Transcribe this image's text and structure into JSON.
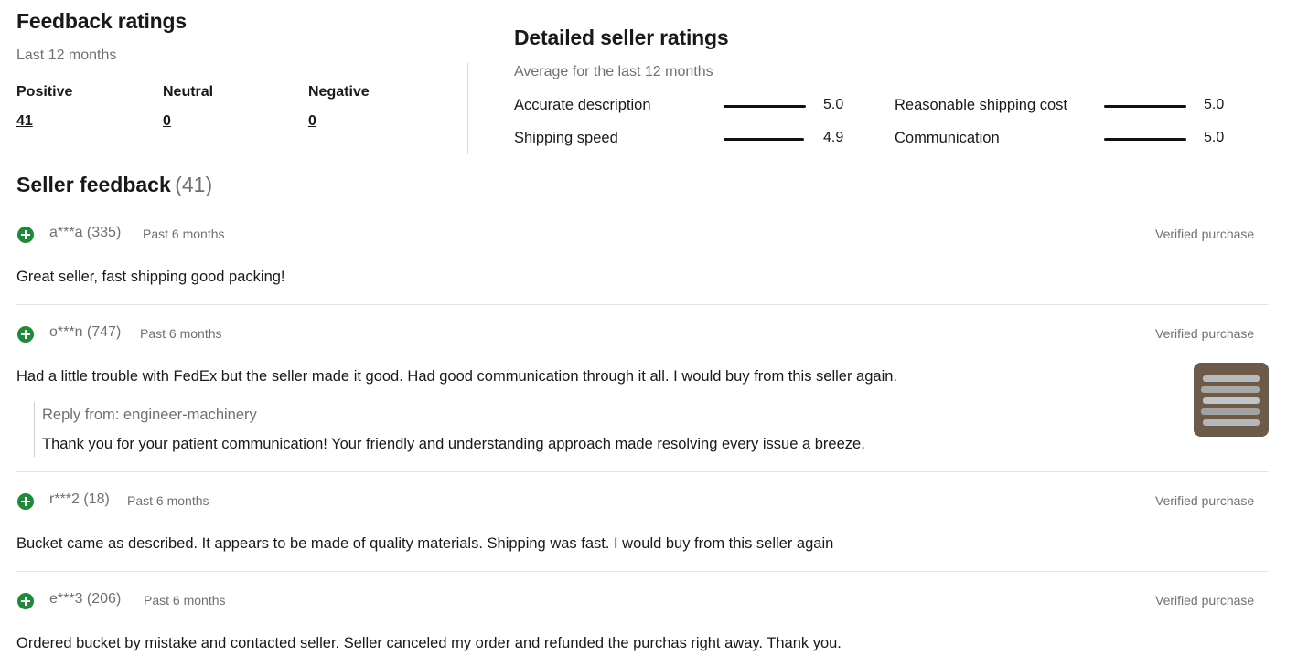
{
  "feedback_ratings": {
    "title": "Feedback ratings",
    "period": "Last 12 months",
    "positive_label": "Positive",
    "neutral_label": "Neutral",
    "negative_label": "Negative",
    "positive_count": "41",
    "neutral_count": "0",
    "negative_count": "0"
  },
  "detailed_ratings": {
    "title": "Detailed seller ratings",
    "period": "Average for the last 12 months",
    "items": [
      {
        "label": "Accurate description",
        "value": "5.0",
        "fraction": 1.0
      },
      {
        "label": "Shipping speed",
        "value": "4.9",
        "fraction": 0.98
      },
      {
        "label": "Reasonable shipping cost",
        "value": "5.0",
        "fraction": 1.0
      },
      {
        "label": "Communication",
        "value": "5.0",
        "fraction": 1.0
      }
    ]
  },
  "seller_feedback": {
    "title": "Seller feedback",
    "count": "(41)",
    "entries": [
      {
        "user": "a***a (335)",
        "time": "Past 6 months",
        "verified": "Verified purchase",
        "comment": "Great seller, fast shipping good packing!"
      },
      {
        "user": "o***n (747)",
        "time": "Past 6 months",
        "verified": "Verified purchase",
        "comment": "Had a little trouble with FedEx but the seller made it good. Had good communication through it all. I would buy from this seller again.",
        "reply_from": "Reply from: engineer-machinery",
        "reply": "Thank you for your patient communication! Your friendly and understanding approach made resolving every issue a breeze."
      },
      {
        "user": "r***2 (18)",
        "time": "Past 6 months",
        "verified": "Verified purchase",
        "comment": "Bucket came as described. It appears to be made of quality materials. Shipping was fast. I would buy from this seller again"
      },
      {
        "user": "e***3 (206)",
        "time": "Past 6 months",
        "verified": "Verified purchase",
        "comment": "Ordered bucket by mistake and contacted seller. Seller canceled my order and refunded the purchas right away. Thank you."
      }
    ]
  },
  "colors": {
    "positive_icon": "#1f8a3a",
    "text": "#191919",
    "muted": "#707070"
  }
}
